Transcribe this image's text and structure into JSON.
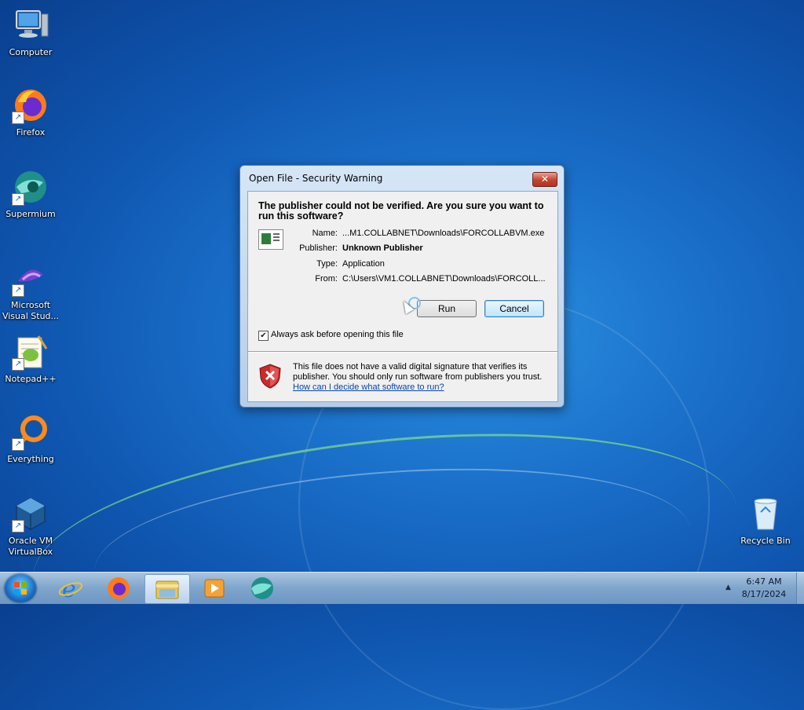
{
  "desktop": {
    "icons": [
      {
        "label": "Computer",
        "icon": "computer-icon"
      },
      {
        "label": "Firefox",
        "icon": "firefox-icon"
      },
      {
        "label": "Supermium",
        "icon": "supermium-icon"
      },
      {
        "label": "Microsoft Visual Stud...",
        "icon": "visual-studio-icon"
      },
      {
        "label": "Notepad++",
        "icon": "notepadpp-icon"
      },
      {
        "label": "Everything",
        "icon": "everything-icon"
      },
      {
        "label": "Oracle VM VirtualBox",
        "icon": "virtualbox-icon"
      },
      {
        "label": "Recycle Bin",
        "icon": "recycle-bin-icon"
      }
    ]
  },
  "dialog": {
    "title": "Open File - Security Warning",
    "close_label": "✕",
    "question": "The publisher could not be verified.  Are you sure you want to run this software?",
    "fields": {
      "name_label": "Name:",
      "name_value": "...M1.COLLABNET\\Downloads\\FORCOLLABVM.exe",
      "publisher_label": "Publisher:",
      "publisher_value": "Unknown Publisher",
      "type_label": "Type:",
      "type_value": "Application",
      "from_label": "From:",
      "from_value": "C:\\Users\\VM1.COLLABNET\\Downloads\\FORCOLL..."
    },
    "run_label": "Run",
    "cancel_label": "Cancel",
    "always_ask_label": "Always ask before opening this file",
    "always_ask_checked": true,
    "warning_text": "This file does not have a valid digital signature that verifies its publisher.  You should only run software from publishers you trust.",
    "help_link": "How can I decide what software to run?"
  },
  "taskbar": {
    "items": [
      "start-orb",
      "internet-explorer-icon",
      "firefox-icon",
      "file-explorer-icon",
      "media-player-icon",
      "supermium-icon"
    ],
    "active_item": "file-explorer-icon",
    "time": "6:47 AM",
    "date": "8/17/2024",
    "tray_arrow": "▲"
  }
}
